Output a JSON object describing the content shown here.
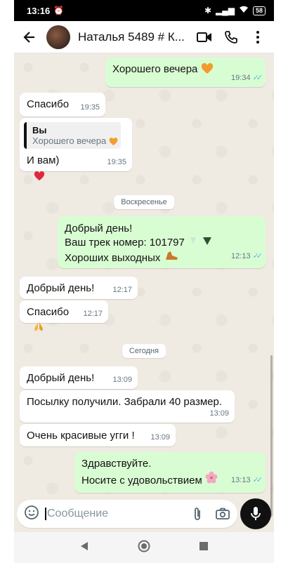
{
  "status": {
    "time": "13:16",
    "battery": "58"
  },
  "header": {
    "contact_name": "Наталья 5489 # К..."
  },
  "messages": {
    "m1": {
      "text": "Хорошего вечера",
      "time": "19:34"
    },
    "m2": {
      "text": "Спасибо",
      "time": "19:35"
    },
    "m3": {
      "quote_author": "Вы",
      "quote_text": "Хорошего вечера",
      "text": "И вам)",
      "time": "19:35"
    },
    "day1": "Воскресенье",
    "m4": {
      "line1": "Добрый день!",
      "line2": "Ваш трек номер: 101797",
      "line3": "Хороших выходных",
      "time": "12:13"
    },
    "m5": {
      "text": "Добрый день!",
      "time": "12:17"
    },
    "m6": {
      "text": "Спасибо",
      "time": "12:17"
    },
    "day2": "Сегодня",
    "m7": {
      "text": "Добрый день!",
      "time": "13:09"
    },
    "m8": {
      "text": "Посылку получили. Забрали 40 размер.",
      "time": "13:09"
    },
    "m9": {
      "text": "Очень красивые угги !",
      "time": "13:09"
    },
    "m10": {
      "line1": "Здравствуйте.",
      "line2": "Носите с удовольствием",
      "time": "13:13"
    }
  },
  "composer": {
    "placeholder": "Сообщение"
  },
  "colors": {
    "outgoing": "#d9fdd3",
    "incoming": "#ffffff",
    "read_ticks": "#53bdeb",
    "background": "#efeae2"
  }
}
